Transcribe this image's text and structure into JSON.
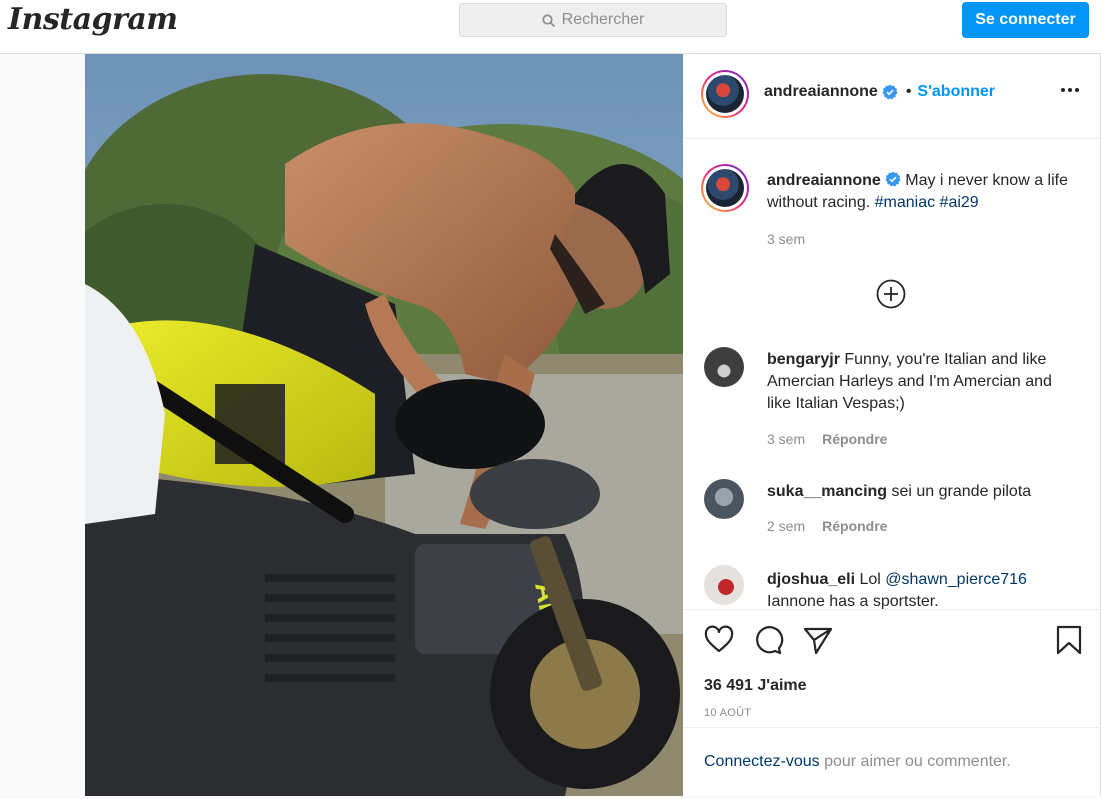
{
  "app": {
    "logo": "Instagram"
  },
  "search": {
    "placeholder": "Rechercher",
    "icon": "search-icon"
  },
  "header_actions": {
    "login_label": "Se connecter"
  },
  "post": {
    "author": "andreaiannone",
    "follow_label": "S'abonner",
    "separator": "•",
    "likes": "36 491 J'aime",
    "date": "10 AOÛT"
  },
  "caption": {
    "user": "andreaiannone",
    "text": " May i never know a life without racing. ",
    "hashtags": [
      "#maniac",
      "#ai29"
    ],
    "time": "3 sem"
  },
  "comments": [
    {
      "user": "bengaryjr",
      "text": " Funny, you're Italian and like Amercian Harleys and I'm Amercian and like Italian Vespas;)",
      "time": "3 sem",
      "reply": "Répondre"
    },
    {
      "user": "suka__mancing",
      "text": " sei un grande pilota",
      "time": "2 sem",
      "reply": "Répondre"
    },
    {
      "user": "djoshua_eli",
      "text": " Lol ",
      "mention": "@shawn_pierce716",
      "text2": " Iannone has a sportster."
    }
  ],
  "footer": {
    "link": "Connectez-vous",
    "text": " pour aimer ou commenter."
  },
  "colors": {
    "accent": "#0095f6",
    "link": "#00376b",
    "muted": "#8e8e8e"
  }
}
